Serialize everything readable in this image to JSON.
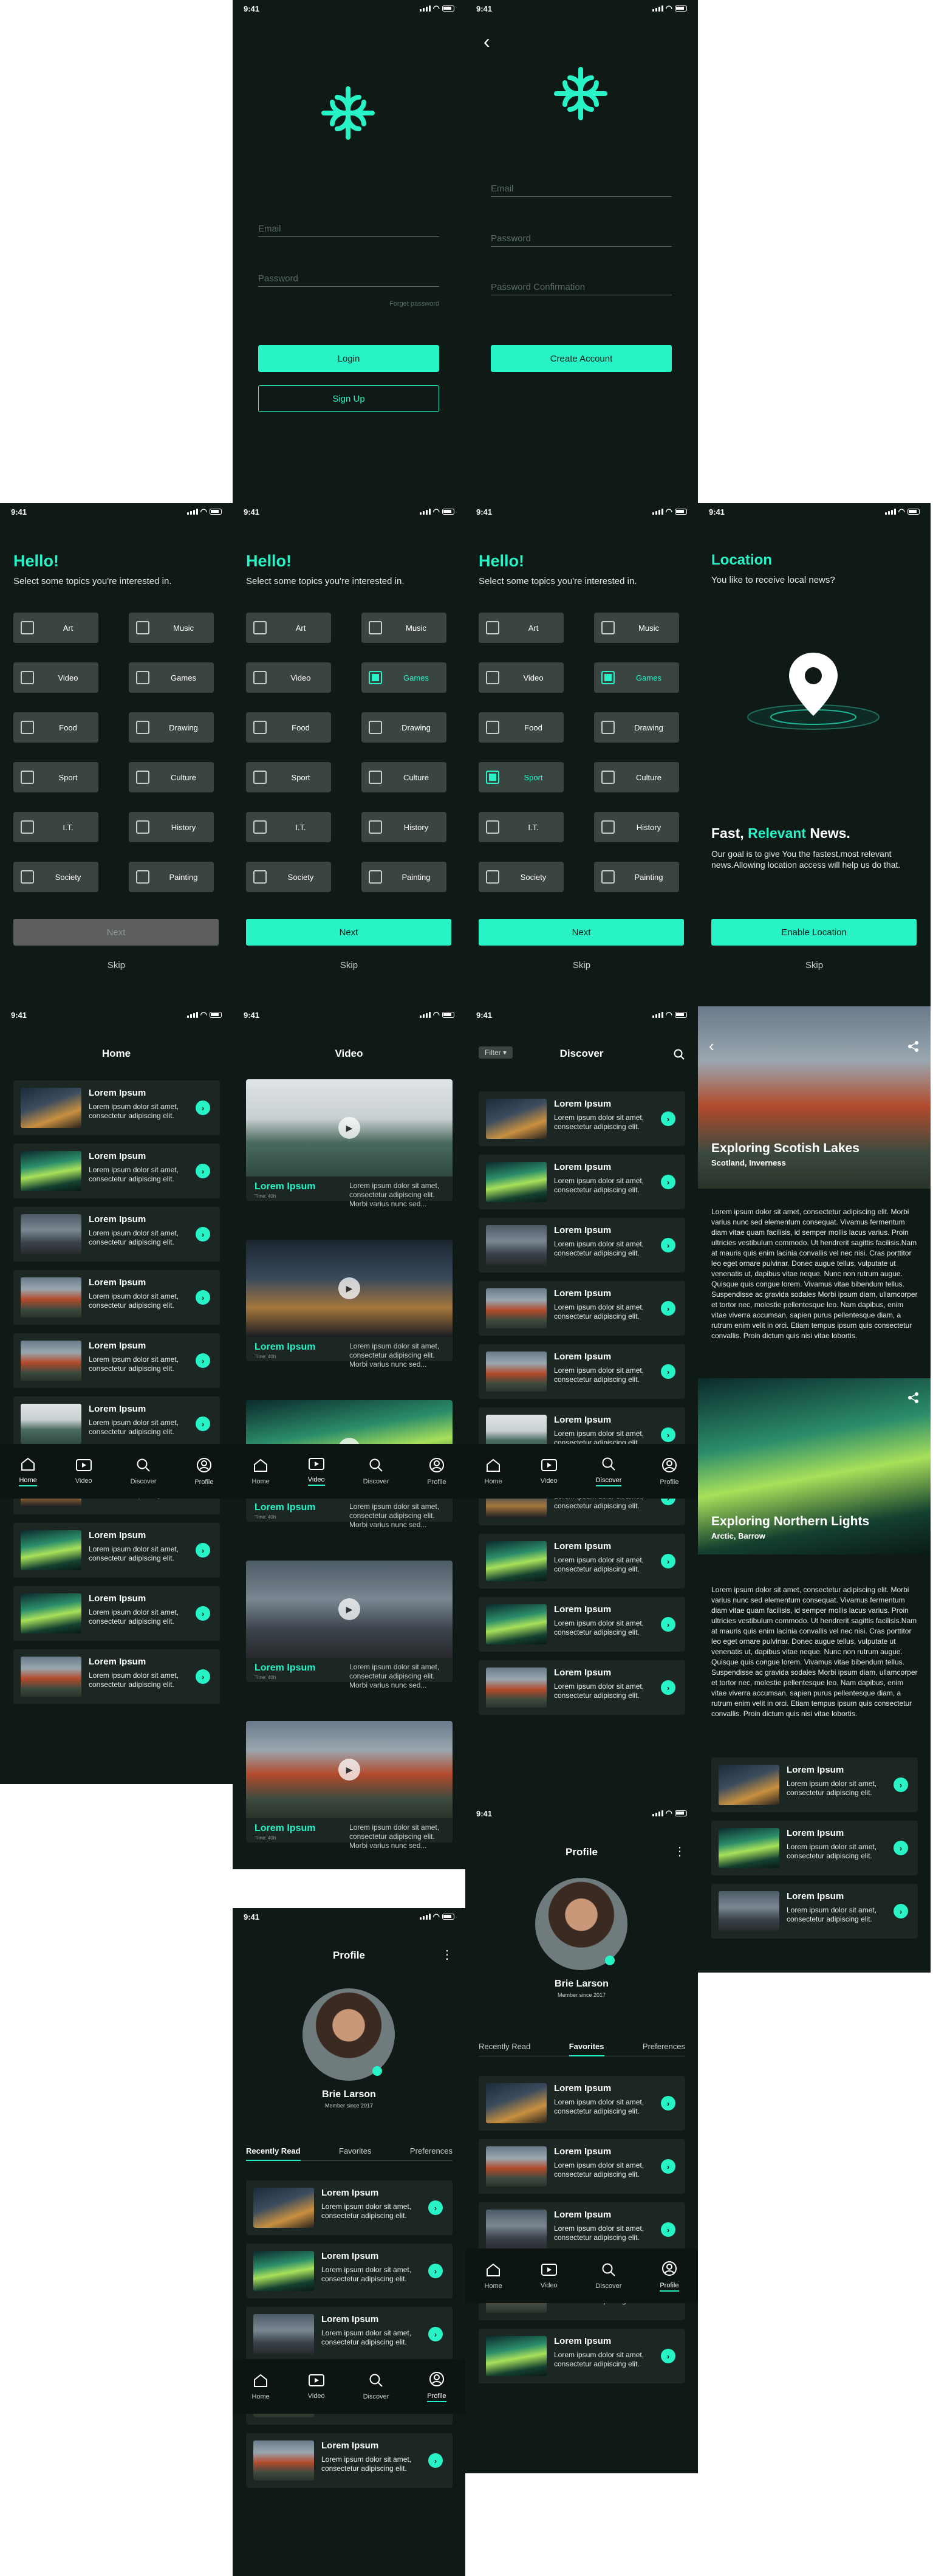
{
  "status_time": "9:41",
  "login": {
    "email_placeholder": "Email",
    "password_placeholder": "Password",
    "forgot": "Forget password",
    "login_label": "Login",
    "signup_label": "Sign Up"
  },
  "signup": {
    "back": "‹",
    "email_placeholder": "Email",
    "password_placeholder": "Password",
    "confirm_placeholder": "Password Confirmation",
    "create_label": "Create Account"
  },
  "topics": {
    "hello": "Hello!",
    "subtitle": "Select some topics you're interested in.",
    "items": [
      "Art",
      "Music",
      "Video",
      "Games",
      "Food",
      "Drawing",
      "Sport",
      "Culture",
      "I.T.",
      "History",
      "Society",
      "Painting"
    ],
    "next": "Next",
    "skip": "Skip"
  },
  "location": {
    "title": "Location",
    "question": "You like to receive local news?",
    "headline_a": "Fast, ",
    "headline_b": "Relevant",
    "headline_c": " News.",
    "body": "Our goal is to give You the fastest,most relevant news.Allowing location access will help us do that.",
    "enable": "Enable Location",
    "skip": "Skip"
  },
  "article": {
    "title": "Lorem Ipsum",
    "desc": "Lorem ipsum dolor sit amet, consectetur adipiscing elit."
  },
  "home": {
    "title": "Home"
  },
  "video": {
    "title": "Video",
    "card_title": "Lorem Ipsum",
    "card_meta": "Time: 40h",
    "card_desc": "Lorem ipsum dolor sit amet, consectetur adipiscing elit. Morbi varius nunc sed..."
  },
  "discover": {
    "title": "Discover",
    "filter": "Filter ▾"
  },
  "nav": {
    "home": "Home",
    "video": "Video",
    "discover": "Discover",
    "profile": "Profile"
  },
  "detail": {
    "title1": "Exploring Scotish Lakes",
    "place1": "Scotland, Inverness",
    "title2": "Exploring Northern Lights",
    "place2": "Arctic, Barrow",
    "body": "Lorem ipsum dolor sit amet, consectetur adipiscing elit. Morbi varius nunc sed elementum consequat. Vivamus fermentum diam vitae quam facilisis, id semper mollis lacus varius. Proin ultricies vestibulum commodo. Ut hendrerit sagittis facilisis.Nam at mauris quis enim lacinia convallis vel nec nisi. Cras porttitor leo eget ornare pulvinar. Donec augue tellus, vulputate ut venenatis ut, dapibus vitae neque. Nunc non rutrum augue. Quisque quis congue lorem. Vivamus vitae bibendum tellus. Suspendisse ac gravida sodales Morbi ipsum diam, ullamcorper et tortor nec, molestie pellentesque leo. Nam dapibus, enim vitae viverra accumsan, sapien purus pellentesque diam, a rutrum enim velit in orci. Etiam tempus ipsum quis consectetur convallis. Proin dictum quis nisi vitae lobortis."
  },
  "profile": {
    "title": "Profile",
    "menu": "⋮",
    "name": "Brie Larson",
    "member": "Member since 2017",
    "tab_recent": "Recently Read",
    "tab_fav": "Favorites",
    "tab_pref": "Preferences"
  },
  "colors": {
    "accent": "#27f3c6",
    "bg": "#0f1a17",
    "card": "#1c2724"
  }
}
